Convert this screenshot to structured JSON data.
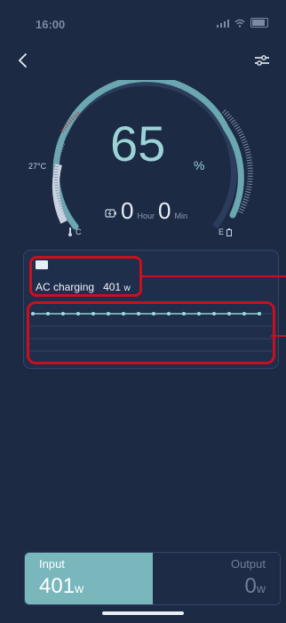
{
  "status": {
    "time": "16:00"
  },
  "gauge": {
    "percent": 65,
    "percent_text": "65",
    "percent_sign": "%",
    "hours": "0",
    "hour_unit": "Hour",
    "mins": "0",
    "min_unit": "Min",
    "temperature": "27°C",
    "left_label": "C",
    "right_label": "E"
  },
  "mode": {
    "label": "AC charging",
    "power": "401",
    "power_unit": "w"
  },
  "tabs": {
    "input_label": "Input",
    "input_value": "401",
    "input_unit": "w",
    "output_label": "Output",
    "output_value": "0",
    "output_unit": "w"
  },
  "colors": {
    "background": "#1c2a44",
    "accent": "#7ab7bd",
    "highlight": "#c8101e"
  }
}
